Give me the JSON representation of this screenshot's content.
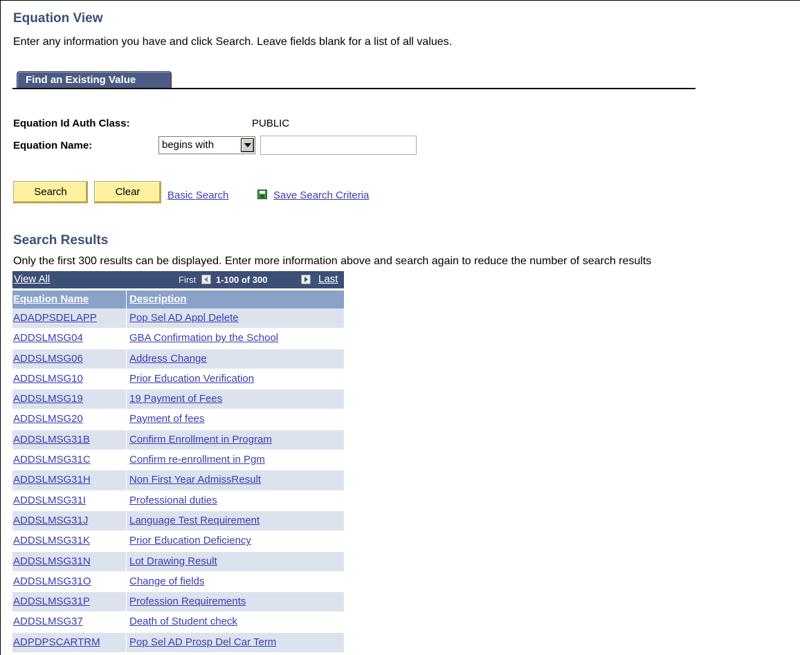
{
  "page": {
    "title": "Equation View",
    "instructions": "Enter any information you have and click Search. Leave fields blank for a list of all values."
  },
  "tab": {
    "label": "Find an Existing Value"
  },
  "form": {
    "auth_class_label": "Equation Id Auth Class:",
    "auth_class_value": "PUBLIC",
    "equation_name_label": "Equation Name:",
    "operator_value": "begins with",
    "equation_name_value": ""
  },
  "actions": {
    "search_label": "Search",
    "clear_label": "Clear",
    "basic_search_label": "Basic Search",
    "save_criteria_label": "Save Search Criteria",
    "save_icon": "save-disk-icon"
  },
  "results": {
    "title": "Search Results",
    "note": "Only the first 300 results can be displayed. Enter more information above and search again to reduce the number of search results",
    "view_all": "View All",
    "first": "First",
    "range": "1-100 of 300",
    "last": "Last",
    "columns": [
      "Equation Name",
      "Description"
    ],
    "rows": [
      [
        "ADADPSDELAPP",
        "Pop Sel AD Appl Delete"
      ],
      [
        "ADDSLMSG04",
        "GBA Confirmation by the School"
      ],
      [
        "ADDSLMSG06",
        "Address Change"
      ],
      [
        "ADDSLMSG10",
        "Prior Education Verification"
      ],
      [
        "ADDSLMSG19",
        "19 Payment of Fees"
      ],
      [
        "ADDSLMSG20",
        "Payment of fees"
      ],
      [
        "ADDSLMSG31B",
        "Confirm Enrollment in Program"
      ],
      [
        "ADDSLMSG31C",
        "Confirm re-enrollment in Pgm"
      ],
      [
        "ADDSLMSG31H",
        "Non First Year AdmissResult"
      ],
      [
        "ADDSLMSG31I",
        "Professional duties"
      ],
      [
        "ADDSLMSG31J",
        "Language Test Requirement"
      ],
      [
        "ADDSLMSG31K",
        "Prior Education Deficiency"
      ],
      [
        "ADDSLMSG31N",
        "Lot Drawing Result"
      ],
      [
        "ADDSLMSG31O",
        "Change of fields"
      ],
      [
        "ADDSLMSG31P",
        "Profession Requirements"
      ],
      [
        "ADDSLMSG37",
        "Death of Student check"
      ],
      [
        "ADPDPSCARTRM",
        "Pop Sel AD Prosp Del Car Term"
      ]
    ]
  },
  "colors": {
    "title": "#3c4f77",
    "grid_header": "#3c4f77",
    "col_header": "#8aa2c8",
    "row_alt": "#dde3ee",
    "link": "#3b3bb3",
    "button": "#fcf1a0"
  }
}
